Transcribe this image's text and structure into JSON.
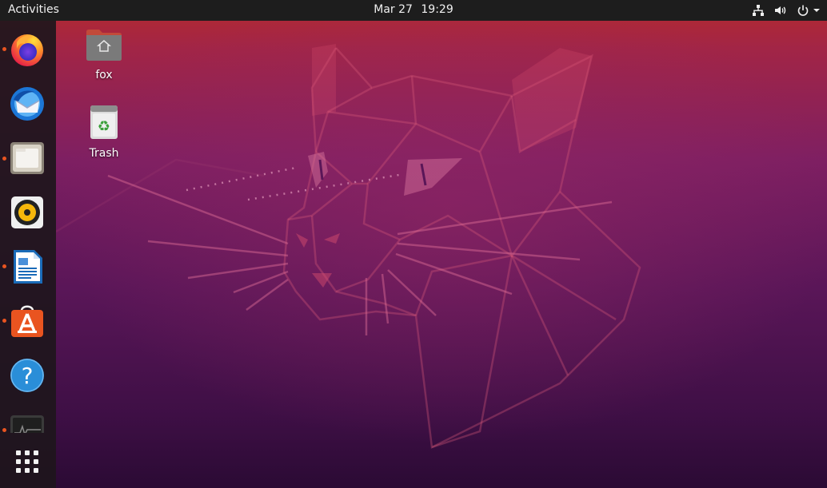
{
  "topbar": {
    "activities_label": "Activities",
    "date": "Mar 27",
    "time": "19:29",
    "tray_icons": [
      "network-icon",
      "volume-icon",
      "power-icon"
    ]
  },
  "dock": {
    "items": [
      {
        "name": "firefox",
        "running": true
      },
      {
        "name": "thunderbird",
        "running": false
      },
      {
        "name": "files",
        "running": true
      },
      {
        "name": "rhythmbox",
        "running": false
      },
      {
        "name": "libreoffice-writer",
        "running": true
      },
      {
        "name": "ubuntu-software",
        "running": true
      },
      {
        "name": "help",
        "running": false
      },
      {
        "name": "system-monitor",
        "running": true
      }
    ],
    "show_apps": "show-applications-icon"
  },
  "desktop": {
    "icons": [
      {
        "label": "fox",
        "icon": "home-folder-icon"
      },
      {
        "label": "Trash",
        "icon": "trash-icon"
      }
    ]
  },
  "colors": {
    "accent": "#e95420",
    "topbar": "#1d1d1d",
    "dock": "#1e161c",
    "wallpaper_top": "#b62a2c",
    "wallpaper_bottom": "#2b0a34"
  }
}
